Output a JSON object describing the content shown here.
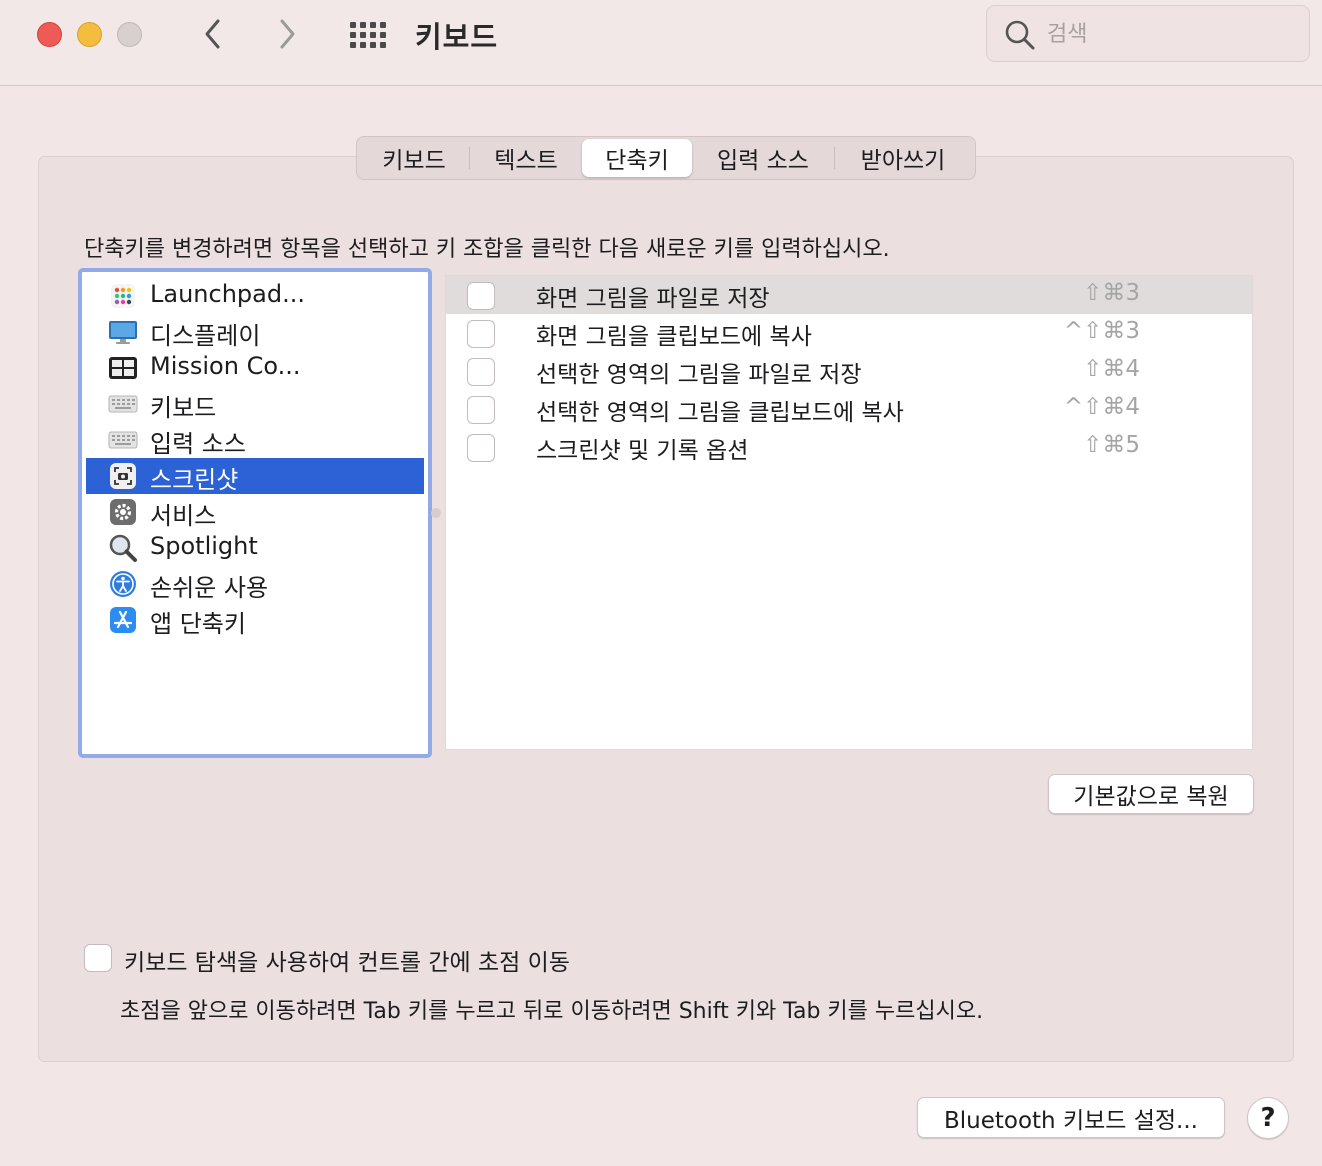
{
  "window": {
    "title": "키보드",
    "search_placeholder": "검색"
  },
  "tabs": [
    {
      "label": "키보드",
      "active": false
    },
    {
      "label": "텍스트",
      "active": false
    },
    {
      "label": "단축키",
      "active": true
    },
    {
      "label": "입력 소스",
      "active": false
    },
    {
      "label": "받아쓰기",
      "active": false
    }
  ],
  "instruction": "단축키를 변경하려면 항목을 선택하고 키 조합을 클릭한 다음 새로운 키를 입력하십시오.",
  "categories": [
    {
      "label": "Launchpad...",
      "icon": "launchpad-icon"
    },
    {
      "label": "디스플레이",
      "icon": "display-icon"
    },
    {
      "label": "Mission Co...",
      "icon": "mission-control-icon"
    },
    {
      "label": "키보드",
      "icon": "keyboard-icon"
    },
    {
      "label": "입력 소스",
      "icon": "keyboard-icon"
    },
    {
      "label": "스크린샷",
      "icon": "screenshot-icon",
      "selected": true
    },
    {
      "label": "서비스",
      "icon": "gear-icon"
    },
    {
      "label": "Spotlight",
      "icon": "magnifier-icon"
    },
    {
      "label": "손쉬운 사용",
      "icon": "accessibility-icon"
    },
    {
      "label": "앱 단축키",
      "icon": "app-store-icon"
    }
  ],
  "shortcuts": [
    {
      "label": "화면 그림을 파일로 저장",
      "key": "⇧⌘3",
      "checked": false
    },
    {
      "label": "화면 그림을 클립보드에 복사",
      "key": "^⇧⌘3",
      "checked": false
    },
    {
      "label": "선택한 영역의 그림을 파일로 저장",
      "key": "⇧⌘4",
      "checked": false
    },
    {
      "label": "선택한 영역의 그림을 클립보드에 복사",
      "key": "^⇧⌘4",
      "checked": false
    },
    {
      "label": "스크린샷 및 기록 옵션",
      "key": "⇧⌘5",
      "checked": false
    }
  ],
  "restore_button": "기본값으로 복원",
  "keyboard_nav": {
    "label": "키보드 탐색을 사용하여 컨트롤 간에 초점 이동",
    "hint": "초점을 앞으로 이동하려면 Tab 키를 누르고 뒤로 이동하려면 Shift 키와 Tab 키를 누르십시오.",
    "checked": false
  },
  "bluetooth_button": "Bluetooth 키보드 설정...",
  "help_button": "?",
  "colors": {
    "selection": "#2c62d6",
    "focus_ring": "#93aae8",
    "background": "#f2e6e6"
  }
}
